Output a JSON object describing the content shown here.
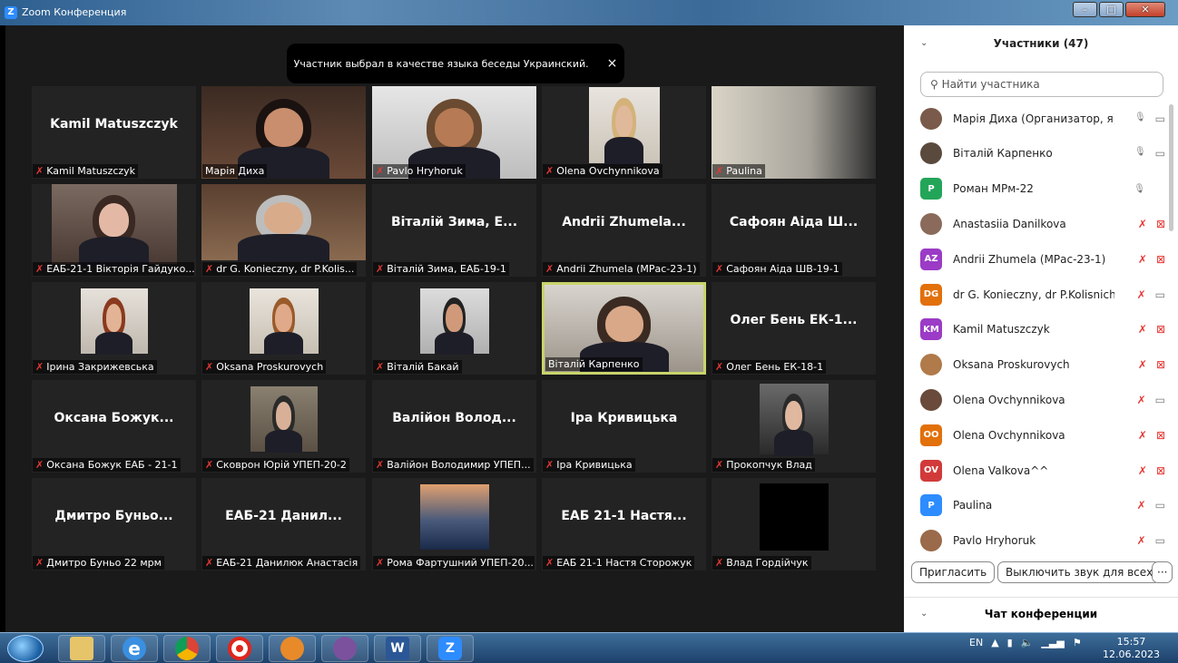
{
  "window": {
    "title": "Zoom Конференция",
    "app_icon": "Z",
    "minimize": "–",
    "maximize": "□",
    "close": "✕"
  },
  "toast": {
    "text": "Участник выбрал в качестве языка беседы Украинский.",
    "close": "×"
  },
  "gallery": [
    {
      "name": "Kamil Matuszczyk",
      "label": "Kamil Matuszczyk",
      "muted": true,
      "video": false
    },
    {
      "name": "",
      "label": "Марія Диха",
      "muted": false,
      "video": true
    },
    {
      "name": "",
      "label": "Pavlo Hryhoruk",
      "muted": true,
      "video": true
    },
    {
      "name": "",
      "label": "Olena Ovchynnikova",
      "muted": true,
      "video": true
    },
    {
      "name": "",
      "label": "Paulina",
      "muted": true,
      "video": true
    },
    {
      "name": "",
      "label": "ЕАБ-21-1 Вікторія Гайдуко...",
      "muted": true,
      "video": true
    },
    {
      "name": "",
      "label": "dr G. Konieczny, dr P.Kolis...",
      "muted": true,
      "video": true
    },
    {
      "name": "Віталій Зима, Е...",
      "label": "Віталій Зима, ЕАБ-19-1",
      "muted": true,
      "video": false
    },
    {
      "name": "Andrii Zhumela...",
      "label": "Andrii Zhumela (МРас-23-1)",
      "muted": true,
      "video": false
    },
    {
      "name": "Сафоян Аіда Ш...",
      "label": "Сафоян Аіда ШВ-19-1",
      "muted": true,
      "video": false
    },
    {
      "name": "",
      "label": "Ірина Закрижевська",
      "muted": true,
      "video": true
    },
    {
      "name": "",
      "label": "Oksana Proskurovych",
      "muted": true,
      "video": true
    },
    {
      "name": "",
      "label": "Віталій Бакай",
      "muted": true,
      "video": true
    },
    {
      "name": "",
      "label": "Віталій Карпенко",
      "muted": false,
      "video": true,
      "active": true
    },
    {
      "name": "Олег Бень ЕК-1...",
      "label": "Олег Бень ЕК-18-1",
      "muted": true,
      "video": false
    },
    {
      "name": "Оксана Божук...",
      "label": "Оксана Божук ЕАБ - 21-1",
      "muted": true,
      "video": false
    },
    {
      "name": "",
      "label": "Сковрон Юрій УПЕП-20-2",
      "muted": true,
      "video": true
    },
    {
      "name": "Валійон Волод...",
      "label": "Валійон Володимир УПЕП...",
      "muted": true,
      "video": false
    },
    {
      "name": "Іра Кривицька",
      "label": "Іра Кривицька",
      "muted": true,
      "video": false
    },
    {
      "name": "",
      "label": "Прокопчук Влад",
      "muted": true,
      "video": true
    },
    {
      "name": "Дмитро Буньо...",
      "label": "Дмитро Буньо 22 мрм",
      "muted": true,
      "video": false
    },
    {
      "name": "ЕАБ-21 Данил...",
      "label": "ЕАБ-21 Данилюк Анастасія",
      "muted": true,
      "video": false
    },
    {
      "name": "",
      "label": "Рома Фартушний УПЕП-20...",
      "muted": true,
      "video": true
    },
    {
      "name": "ЕАБ 21-1 Настя...",
      "label": "ЕАБ 21-1 Настя Сторожук",
      "muted": true,
      "video": false
    },
    {
      "name": "",
      "label": "Влад Гордійчук",
      "muted": true,
      "video": true
    }
  ],
  "panel": {
    "title": "Участники (47)",
    "collapse_icon": "chevron-down-icon",
    "search_placeholder": "Найти участника",
    "participants": [
      {
        "name": "Марія Диха (Организатор, я)",
        "avatar": "",
        "color": "#7a5a4a",
        "mic": "on",
        "video": "on"
      },
      {
        "name": "Віталій Карпенко",
        "avatar": "",
        "color": "#5a4a3e",
        "mic": "speaking",
        "video": "on"
      },
      {
        "name": "Роман МРм-22",
        "avatar": "P",
        "color": "#23a559",
        "mic": "on",
        "video": "none"
      },
      {
        "name": "Anastasiia Danilkova",
        "avatar": "",
        "color": "#8a6a5a",
        "mic": "off",
        "video": "off"
      },
      {
        "name": "Andrii Zhumela (МРас-23-1)",
        "avatar": "AZ",
        "color": "#9b3bc6",
        "mic": "off",
        "video": "off"
      },
      {
        "name": "dr G. Konieczny, dr P.Kolisnich...",
        "avatar": "DG",
        "color": "#e2700b",
        "mic": "off",
        "video": "on"
      },
      {
        "name": "Kamil Matuszczyk",
        "avatar": "KM",
        "color": "#9b3bc6",
        "mic": "off",
        "video": "off"
      },
      {
        "name": "Oksana Proskurovych",
        "avatar": "",
        "color": "#b07a4a",
        "mic": "off",
        "video": "off"
      },
      {
        "name": "Olena Ovchynnikova",
        "avatar": "",
        "color": "#6a4a3a",
        "mic": "off",
        "video": "on"
      },
      {
        "name": "Olena Ovchynnikova",
        "avatar": "OO",
        "color": "#e2700b",
        "mic": "off",
        "video": "off"
      },
      {
        "name": "Olena Valkova^^",
        "avatar": "OV",
        "color": "#d23a3a",
        "mic": "off",
        "video": "off"
      },
      {
        "name": "Paulina",
        "avatar": "P",
        "color": "#2d8cff",
        "mic": "off",
        "video": "on"
      },
      {
        "name": "Pavlo Hryhoruk",
        "avatar": "",
        "color": "#9a6a4a",
        "mic": "off",
        "video": "on"
      }
    ],
    "invite_label": "Пригласить",
    "mute_all_label": "Выключить звук для всех",
    "more_label": "···",
    "chat_title": "Чат конференции"
  },
  "taskbar": {
    "apps": [
      "folder",
      "ie",
      "chrome",
      "opera",
      "camera",
      "viber",
      "word",
      "zoom"
    ],
    "word_letter": "W",
    "zoom_letter": "Z",
    "ie_letter": "e",
    "lang": "EN",
    "time": "15:57",
    "date": "12.06.2023"
  }
}
